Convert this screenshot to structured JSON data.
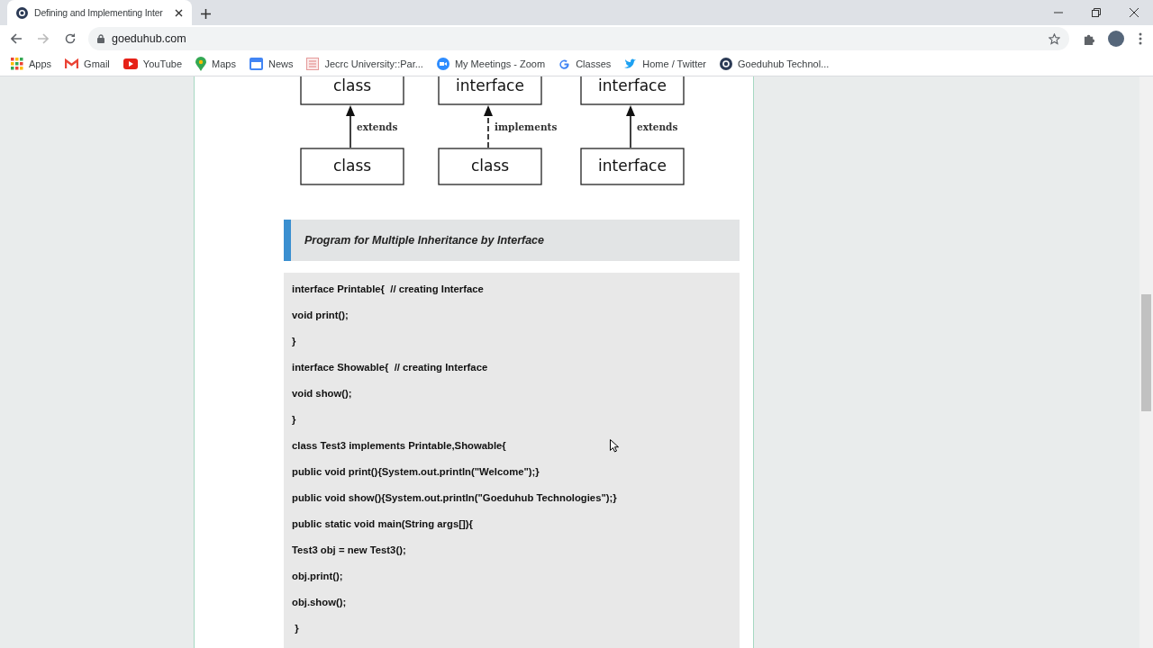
{
  "browser": {
    "tab": {
      "title": "Defining and Implementing Inter",
      "selected": true
    },
    "address": "goeduhub.com",
    "bookmarks": [
      {
        "label": "Apps",
        "kind": "apps"
      },
      {
        "label": "Gmail",
        "kind": "mail"
      },
      {
        "label": "YouTube",
        "kind": "video"
      },
      {
        "label": "Maps",
        "kind": "pin"
      },
      {
        "label": "News",
        "kind": "news"
      },
      {
        "label": "Jecrc University::Par...",
        "kind": "doc"
      },
      {
        "label": "My Meetings - Zoom",
        "kind": "camera"
      },
      {
        "label": "Classes",
        "kind": "g"
      },
      {
        "label": "Home / Twitter",
        "kind": "bird"
      },
      {
        "label": "Goeduhub Technol...",
        "kind": "site"
      }
    ]
  },
  "diagram": [
    {
      "parent": "class",
      "child": "class",
      "relation": "extends",
      "kind": "solid"
    },
    {
      "parent": "interface",
      "child": "class",
      "relation": "implements",
      "kind": "dashed"
    },
    {
      "parent": "interface",
      "child": "interface",
      "relation": "extends",
      "kind": "solid"
    }
  ],
  "heading": "Program for Multiple Inheritance by Interface",
  "code": [
    "interface Printable{  // creating Interface",
    "void print();",
    "}",
    "interface Showable{  // creating Interface",
    "void show();",
    "}",
    "class Test3 implements Printable,Showable{",
    "public void print(){System.out.println(\"Welcome\");}",
    "public void show(){System.out.println(\"Goeduhub Technologies\");}",
    "public static void main(String args[]){",
    "Test3 obj = new Test3();",
    "obj.print();",
    "obj.show();",
    " }"
  ]
}
